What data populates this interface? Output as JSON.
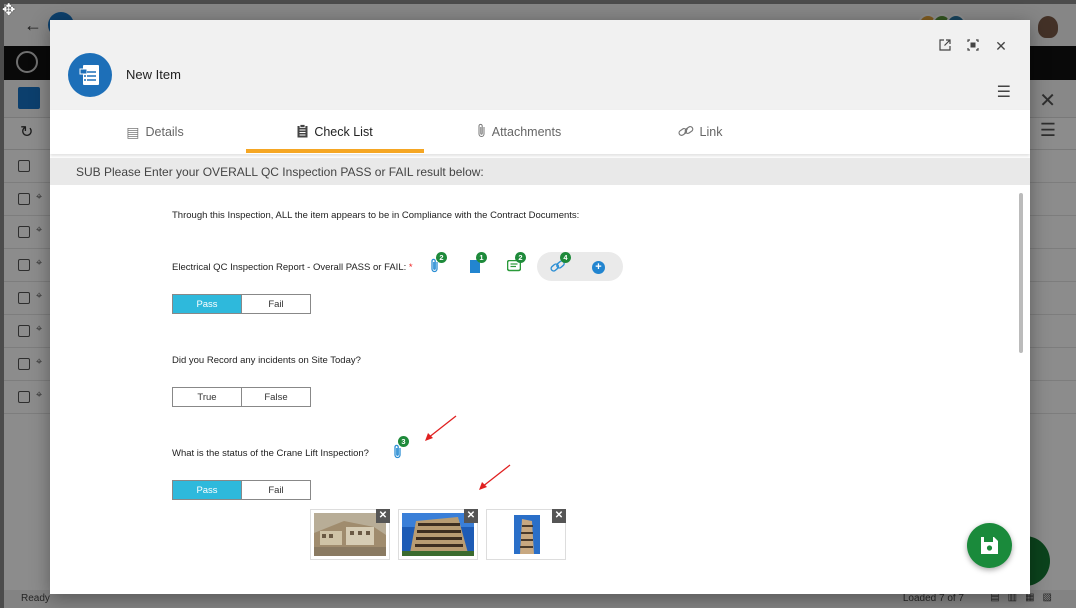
{
  "background_app": {
    "status_left": "Ready",
    "status_right": "Loaded 7 of 7",
    "list_rows": 7
  },
  "modal": {
    "title": "New Item",
    "header_icons": [
      "popout-icon",
      "maximize-icon",
      "close-icon",
      "menu-icon"
    ],
    "tabs": [
      {
        "label": "Details",
        "icon": "details-icon",
        "active": false
      },
      {
        "label": "Check List",
        "icon": "clipboard-icon",
        "active": true
      },
      {
        "label": "Attachments",
        "icon": "paperclip-icon",
        "active": false
      },
      {
        "label": "Link",
        "icon": "link-icon",
        "active": false
      }
    ],
    "active_tab_color": "#f5a623",
    "section_banner": "SUB Please Enter your OVERALL QC Inspection PASS or FAIL result below:"
  },
  "form": {
    "intro": "Through this Inspection, ALL the item appears to be in Compliance with the Contract Documents:",
    "q1": {
      "label": "Electrical QC Inspection Report - Overall PASS or FAIL:",
      "required_mark": "*",
      "options": [
        "Pass",
        "Fail"
      ],
      "selected": "Pass",
      "counts": {
        "attachments": "2",
        "documents": "1",
        "comments": "2",
        "links": "4"
      }
    },
    "q2": {
      "label": "Did you Record any incidents on Site Today?",
      "options": [
        "True",
        "False"
      ],
      "selected": ""
    },
    "q3": {
      "label": "What is the status of the Crane Lift Inspection?",
      "options": [
        "Pass",
        "Fail"
      ],
      "selected": "Pass",
      "counts": {
        "attachments": "3"
      },
      "photos": 3
    },
    "accent_color": "#2eb9dc",
    "badge_color": "#1e8a3a"
  },
  "save_fab_color": "#1a8a3b"
}
